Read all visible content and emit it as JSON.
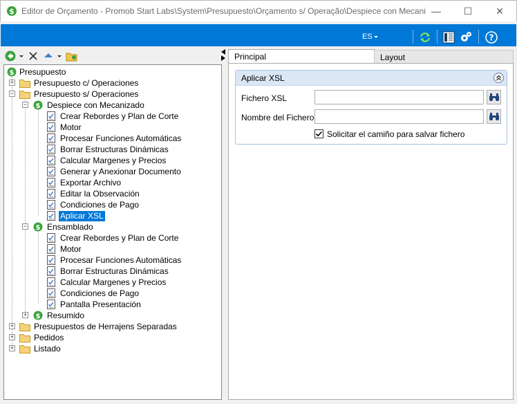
{
  "window": {
    "title": "Editor de Orçamento - Promob Start Labs\\System\\Presupuesto\\Orçamento s/ Operação\\Despiece con Mecanizado",
    "minimize_glyph": "—",
    "maximize_glyph": "☐",
    "close_glyph": "✕"
  },
  "toolbar": {
    "language": "ES",
    "icons": [
      "refresh-icon",
      "document-view-icon",
      "settings-icon",
      "help-icon"
    ]
  },
  "left_toolbar": {
    "icons": [
      "back-icon",
      "delete-icon",
      "move-up-icon",
      "folder-open-icon"
    ]
  },
  "tree": {
    "root": "Presupuesto",
    "items": [
      {
        "label": "Presupuesto c/ Operaciones",
        "type": "folder",
        "expander": "+"
      },
      {
        "label": "Presupuesto s/ Operaciones",
        "type": "folder",
        "expander": "−"
      },
      {
        "label": "Despiece con Mecanizado",
        "type": "budget",
        "expander": "−"
      },
      {
        "label": "Crear Rebordes y Plan de Corte",
        "type": "doc"
      },
      {
        "label": "Motor",
        "type": "doc"
      },
      {
        "label": "Procesar Funciones Automáticas",
        "type": "doc"
      },
      {
        "label": "Borrar Estructuras Dinámicas",
        "type": "doc"
      },
      {
        "label": "Calcular Margenes y Precios",
        "type": "doc"
      },
      {
        "label": "Generar y Anexionar Documento",
        "type": "doc"
      },
      {
        "label": "Exportar Archivo",
        "type": "doc"
      },
      {
        "label": "Editar la Observación",
        "type": "doc"
      },
      {
        "label": "Condiciones de Pago",
        "type": "doc"
      },
      {
        "label": "Aplicar XSL",
        "type": "doc",
        "selected": true
      },
      {
        "label": "Ensamblado",
        "type": "budget",
        "expander": "−"
      },
      {
        "label": "Crear Rebordes y Plan de Corte",
        "type": "doc"
      },
      {
        "label": "Motor",
        "type": "doc"
      },
      {
        "label": "Procesar Funciones Automáticas",
        "type": "doc"
      },
      {
        "label": "Borrar Estructuras Dinámicas",
        "type": "doc"
      },
      {
        "label": "Calcular Margenes y Precios",
        "type": "doc"
      },
      {
        "label": "Condiciones de Pago",
        "type": "doc"
      },
      {
        "label": "Pantalla Presentación",
        "type": "doc"
      },
      {
        "label": "Resumido",
        "type": "budget",
        "expander": "+"
      },
      {
        "label": "Presupuestos de Herrajens Separadas",
        "type": "folder",
        "expander": "+"
      },
      {
        "label": "Pedidos",
        "type": "folder",
        "expander": "+"
      },
      {
        "label": "Listado",
        "type": "folder",
        "expander": "+"
      }
    ]
  },
  "tabs": {
    "principal": "Principal",
    "layout": "Layout"
  },
  "group": {
    "title": "Aplicar XSL",
    "fichero_label": "Fichero XSL",
    "fichero_value": "",
    "nombre_label": "Nombre del Fichero",
    "nombre_value": "",
    "checkbox_label": "Solicitar el camiño para salvar fichero",
    "checkbox_checked": true
  },
  "colors": {
    "accent": "#0078d7",
    "folder": "#f3c64b",
    "budget_icon": "#3aa33a"
  }
}
